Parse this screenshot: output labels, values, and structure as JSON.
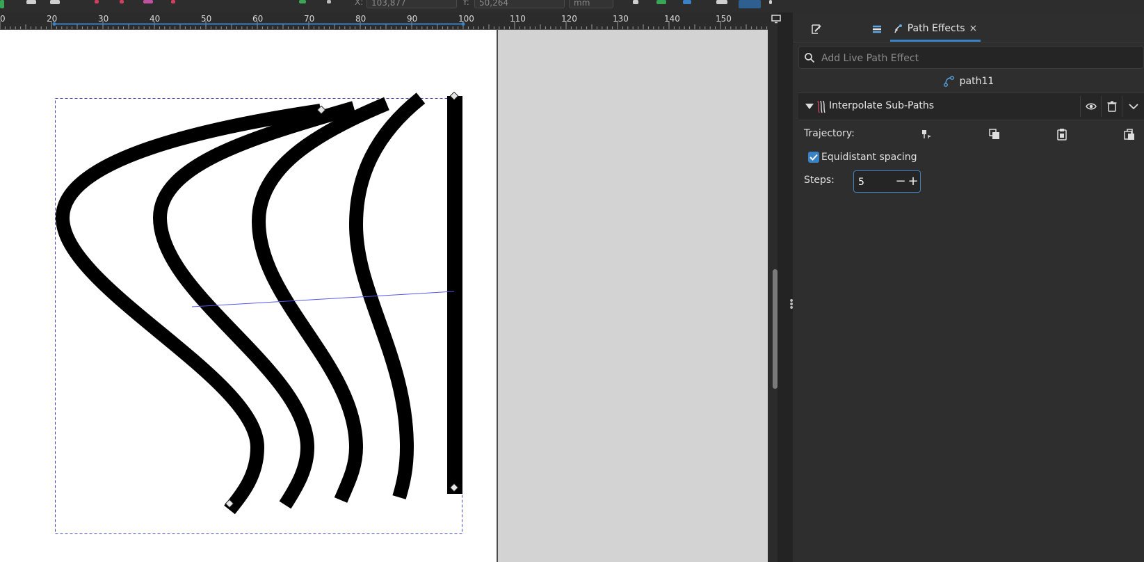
{
  "toolbar": {
    "x_label": "X:",
    "x_value": "103,877",
    "y_label": "Y:",
    "y_value": "50,264",
    "units": "mm"
  },
  "ruler": {
    "ticks": [
      "0",
      "20",
      "30",
      "40",
      "50",
      "60",
      "70",
      "80",
      "90",
      "100",
      "110",
      "120",
      "130",
      "140",
      "150"
    ]
  },
  "dock": {
    "tabs": [
      {
        "icon": "fill-stroke-icon",
        "label": ""
      },
      {
        "icon": "layers-icon",
        "label": ""
      },
      {
        "icon": "path-effects-icon",
        "label": "Path Effects",
        "close": "×"
      }
    ],
    "search": {
      "placeholder": "Add Live Path Effect"
    },
    "path_name": "path11",
    "effect": {
      "title": "Interpolate Sub-Paths",
      "trajectory_label": "Trajectory:",
      "equidistant_label": "Equidistant spacing",
      "equidistant_checked": true,
      "steps_label": "Steps:",
      "steps_value": "5",
      "minus": "−",
      "plus": "+"
    }
  },
  "colors": {
    "accent": "#3b82c4",
    "panel_bg": "#2e2e2e",
    "canvas_bg": "#d3d3d3"
  }
}
